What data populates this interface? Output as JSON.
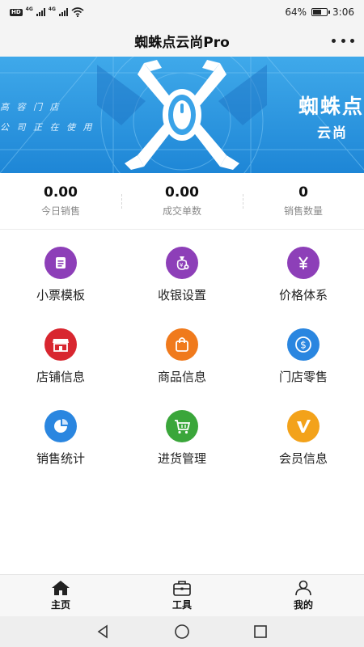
{
  "status_bar": {
    "network_chips": [
      "HD",
      "4G",
      "4G"
    ],
    "battery_percent": "64%",
    "battery_level": 0.64,
    "time": "3:06"
  },
  "header": {
    "title": "蜘蛛点云尚Pro",
    "more_icon": "more-dots-icon"
  },
  "banner": {
    "left_lines": [
      "高 容 门 店",
      "公 司 正 在 使 用"
    ],
    "brand": "蜘蛛点",
    "sub": "云尚",
    "colors": {
      "background": "#2b95df",
      "logo": "#ffffff"
    }
  },
  "stats": [
    {
      "value": "0.00",
      "label": "今日销售"
    },
    {
      "value": "0.00",
      "label": "成交单数"
    },
    {
      "value": "0",
      "label": "销售数量"
    }
  ],
  "menu": [
    {
      "label": "小票模板",
      "icon": "receipt-icon",
      "color": "#8d3fb8"
    },
    {
      "label": "收银设置",
      "icon": "money-bag-icon",
      "color": "#8d3fb8"
    },
    {
      "label": "价格体系",
      "icon": "yen-icon",
      "color": "#8d3fb8"
    },
    {
      "label": "店铺信息",
      "icon": "store-icon",
      "color": "#d8262f"
    },
    {
      "label": "商品信息",
      "icon": "shopping-bag-icon",
      "color": "#f07a1c"
    },
    {
      "label": "门店零售",
      "icon": "dollar-icon",
      "color": "#2a86e0"
    },
    {
      "label": "销售统计",
      "icon": "pie-chart-icon",
      "color": "#2a86e0"
    },
    {
      "label": "进货管理",
      "icon": "cart-icon",
      "color": "#3aa63a"
    },
    {
      "label": "会员信息",
      "icon": "vip-icon",
      "color": "#f3a21a"
    }
  ],
  "tabs": [
    {
      "label": "主页",
      "icon": "home-icon"
    },
    {
      "label": "工具",
      "icon": "toolbox-icon"
    },
    {
      "label": "我的",
      "icon": "user-icon"
    }
  ],
  "system_nav": [
    "back-icon",
    "home-circle-icon",
    "recents-icon"
  ]
}
